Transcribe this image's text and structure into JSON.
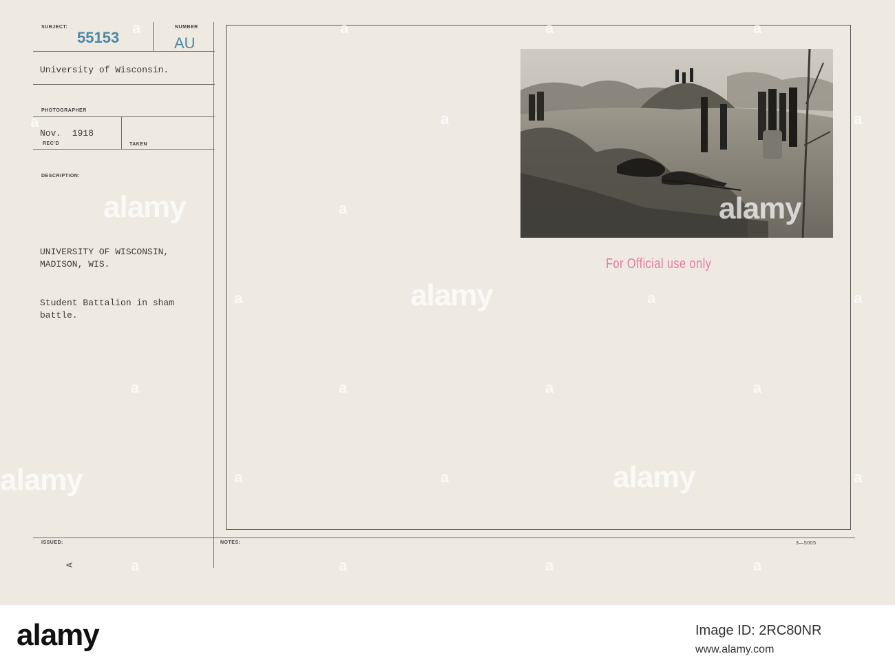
{
  "card": {
    "subject_label": "SUBJECT:",
    "subject_number": "55153",
    "number_label": "NUMBER",
    "number_code": "AU",
    "university_line": "University of Wisconsin.",
    "photographer_label": "PHOTOGRAPHER",
    "received_date": "Nov.  1918",
    "recd_label": "REC'D",
    "taken_label": "TAKEN",
    "description_label": "DESCRIPTION:",
    "location_line1": "UNIVERSITY OF WISCONSIN,",
    "location_line2": "MADISON, WIS.",
    "description_line1": "Student Battalion in sham",
    "description_line2": "battle.",
    "issued_label": "ISSUED:",
    "issued_mark": "A",
    "notes_label": "NOTES:",
    "form_number": "3—5005",
    "official_stamp": "For Official use only"
  },
  "photo": {
    "subject": "Student Battalion in sham battle"
  },
  "watermark": {
    "text": "alamy",
    "letter": "a"
  },
  "footer": {
    "logo": "alamy",
    "image_id": "Image ID: 2RC80NR",
    "url": "www.alamy.com"
  },
  "colors": {
    "card_background": "#eeeae2",
    "stamp_blue": "#4d86a6",
    "stamp_pink": "#e47ca2",
    "ink": "#3b3b3b"
  }
}
